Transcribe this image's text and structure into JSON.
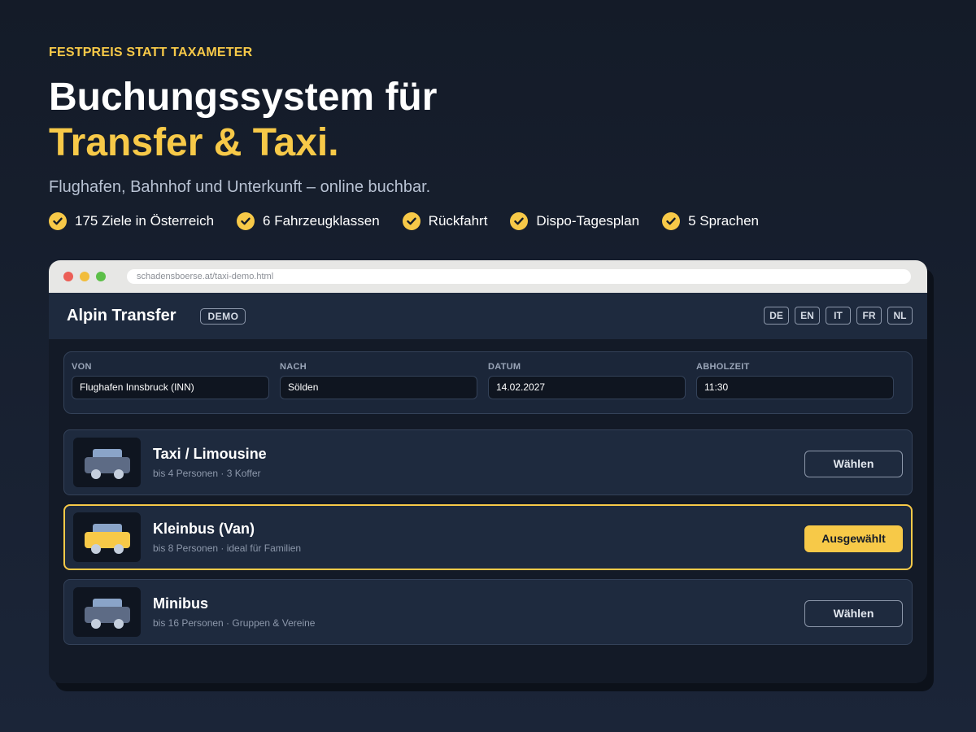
{
  "hero": {
    "eyebrow": "FESTPREIS STATT TAXAMETER",
    "headline_line1": "Buchungssystem für",
    "headline_line2": "Transfer & Taxi.",
    "subline": "Flughafen, Bahnhof und Unterkunft – online buchbar.",
    "features": [
      {
        "label": "175 Ziele in Österreich",
        "icon": "check-circle-icon"
      },
      {
        "label": "6 Fahrzeugklassen",
        "icon": "check-circle-icon"
      },
      {
        "label": "Rückfahrt",
        "icon": "check-circle-icon"
      },
      {
        "label": "Dispo-Tagesplan",
        "icon": "check-circle-icon"
      },
      {
        "label": "5 Sprachen",
        "icon": "check-circle-icon"
      }
    ]
  },
  "browser": {
    "url": "schadensboerse.at/taxi-demo.html"
  },
  "app": {
    "brand": "Alpin Transfer",
    "badge": "DEMO",
    "languages": [
      "DE",
      "EN",
      "IT",
      "FR",
      "NL"
    ],
    "form": {
      "from": {
        "label": "VON",
        "value": "Flughafen Innsbruck (INN)"
      },
      "to": {
        "label": "NACH",
        "value": "Sölden"
      },
      "date": {
        "label": "DATUM",
        "value": "14.02.2027"
      },
      "time": {
        "label": "ABHOLZEIT",
        "value": "11:30"
      }
    },
    "vehicles": [
      {
        "name": "Taxi / Limousine",
        "desc": "bis 4 Personen · 3 Koffer",
        "button": "Wählen",
        "selected": false,
        "icon": "car-icon"
      },
      {
        "name": "Kleinbus (Van)",
        "desc": "bis 8 Personen · ideal für Familien",
        "button": "Ausgewählt",
        "selected": true,
        "icon": "car-icon"
      },
      {
        "name": "Minibus",
        "desc": "bis 16 Personen · Gruppen & Vereine",
        "button": "Wählen",
        "selected": false,
        "icon": "car-icon"
      }
    ]
  },
  "colors": {
    "accent": "#f7c948",
    "background": "#141b28",
    "panel": "#1e2a3e",
    "car_default": "#5d6b85",
    "car_default_roof": "#8aa4c8",
    "car_selected": "#f7c948"
  }
}
